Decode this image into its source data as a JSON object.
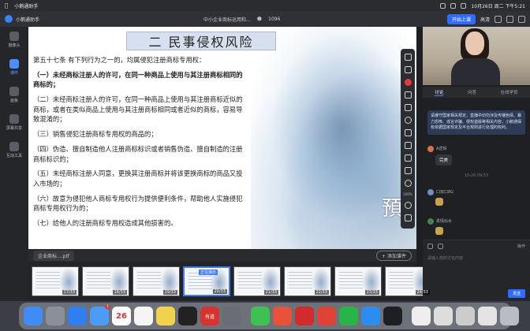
{
  "menubar": {
    "app_name": "小鹅通助手",
    "datetime": "10月26日 周二 下午5:21"
  },
  "app": {
    "title": "小鹅通助手",
    "course_title": "中小企业商标运用和...",
    "viewers": "1096",
    "start_button": "开始上课",
    "quality": "高清"
  },
  "sidebar": {
    "items": [
      {
        "label": "摄像头"
      },
      {
        "label": "课件"
      },
      {
        "label": "画板"
      },
      {
        "label": "屏幕共享"
      },
      {
        "label": "互动工具"
      }
    ]
  },
  "slide": {
    "title": "二 民事侵权风险",
    "intro": "第五十七条 有下列行为之一的，均属侵犯注册商标专用权：",
    "items": [
      "（一）未经商标注册人的许可，在同一种商品上使用与其注册商标相同的商标的；",
      "（二）未经商标注册人的许可，在同一种商品上使用与其注册商标近似的商标，或者在类似商品上使用与其注册商标相同或者近似的商标，容易导致混淆的；",
      "（三）销售侵犯注册商标专用权的商品的；",
      "（四）伪造、擅自制造他人注册商标标识或者销售伪造、擅自制造的注册商标标识的；",
      "（五）未经商标注册人同意，更换其注册商标并将该更换商标的商品又投入市场的；",
      "（六）故意为侵犯他人商标专用权行为提供便利条件，帮助他人实施侵犯商标专用权行为的；",
      "（七）给他人的注册商标专用权造成其他损害的。"
    ],
    "decor_char": "預"
  },
  "toolbar": {
    "zoom": "100%"
  },
  "strip": {
    "file_name": "企业商标....ptf",
    "add_button": "+ 添加课件",
    "live_label": "正在演示",
    "thumbs": [
      {
        "num": "17/33"
      },
      {
        "num": "18/33"
      },
      {
        "num": "19/33"
      },
      {
        "num": "20/33"
      },
      {
        "num": "21/33"
      },
      {
        "num": "22/33"
      },
      {
        "num": "23/33"
      },
      {
        "num": "24/33"
      }
    ]
  },
  "right_panel": {
    "tabs": [
      "讨论",
      "问答",
      "在线学员"
    ],
    "notice": "请遵守国家相关规定，直播中切勿涉及传播色情、暴力恐怖、谣言诈骗、侵权盗版等相关内容，小鹅通保有依据国家规定及平台规则进行处理的权利。",
    "msg1_user": "A逻辑",
    "msg1_text": "完美",
    "time": "10-26 09:53",
    "msg2_user": "口双口8G",
    "msg3_user": "柔情似水",
    "tools_label": "操作",
    "input_placeholder": "请输入您的讨论内容",
    "send_button": "发送"
  },
  "dock": {
    "calendar_day": "26",
    "youdao_label": "有道",
    "mail_badge": "1"
  }
}
